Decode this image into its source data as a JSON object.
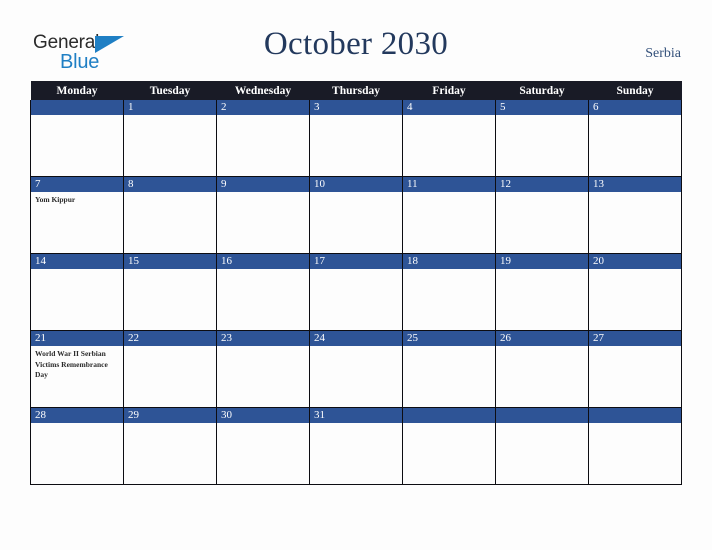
{
  "logo": {
    "word_one": "General",
    "word_two": "Blue",
    "triangle_icon": "triangle-icon",
    "brand_blue": "#1f7fc4",
    "brand_dark": "#2b2b2b"
  },
  "header": {
    "title": "October 2030",
    "country": "Serbia",
    "title_color": "#23395d"
  },
  "calendar": {
    "weekday_headers": [
      "Monday",
      "Tuesday",
      "Wednesday",
      "Thursday",
      "Friday",
      "Saturday",
      "Sunday"
    ],
    "header_bg": "#191b26",
    "daybar_bg": "#2e5496",
    "weeks": [
      [
        {
          "day": "",
          "events": []
        },
        {
          "day": "1",
          "events": []
        },
        {
          "day": "2",
          "events": []
        },
        {
          "day": "3",
          "events": []
        },
        {
          "day": "4",
          "events": []
        },
        {
          "day": "5",
          "events": []
        },
        {
          "day": "6",
          "events": []
        }
      ],
      [
        {
          "day": "7",
          "events": [
            "Yom Kippur"
          ]
        },
        {
          "day": "8",
          "events": []
        },
        {
          "day": "9",
          "events": []
        },
        {
          "day": "10",
          "events": []
        },
        {
          "day": "11",
          "events": []
        },
        {
          "day": "12",
          "events": []
        },
        {
          "day": "13",
          "events": []
        }
      ],
      [
        {
          "day": "14",
          "events": []
        },
        {
          "day": "15",
          "events": []
        },
        {
          "day": "16",
          "events": []
        },
        {
          "day": "17",
          "events": []
        },
        {
          "day": "18",
          "events": []
        },
        {
          "day": "19",
          "events": []
        },
        {
          "day": "20",
          "events": []
        }
      ],
      [
        {
          "day": "21",
          "events": [
            "World War II Serbian Victims Remembrance Day"
          ]
        },
        {
          "day": "22",
          "events": []
        },
        {
          "day": "23",
          "events": []
        },
        {
          "day": "24",
          "events": []
        },
        {
          "day": "25",
          "events": []
        },
        {
          "day": "26",
          "events": []
        },
        {
          "day": "27",
          "events": []
        }
      ],
      [
        {
          "day": "28",
          "events": []
        },
        {
          "day": "29",
          "events": []
        },
        {
          "day": "30",
          "events": []
        },
        {
          "day": "31",
          "events": []
        },
        {
          "day": "",
          "events": []
        },
        {
          "day": "",
          "events": []
        },
        {
          "day": "",
          "events": []
        }
      ]
    ]
  }
}
